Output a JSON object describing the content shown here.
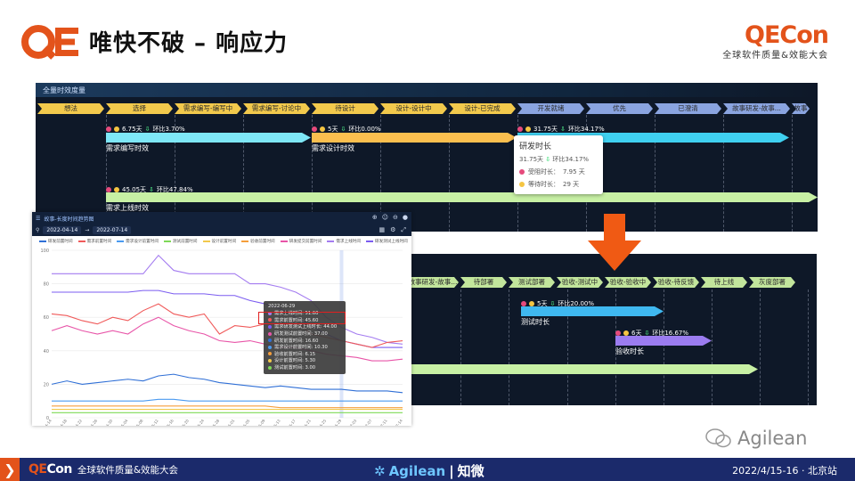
{
  "header": {
    "title": "唯快不破 – 响应力",
    "brand_name_a": "QE",
    "brand_name_b": "Con",
    "brand_sub": "全球软件质量&效能大会"
  },
  "top_panel": {
    "title": "全量时效度量",
    "stages": [
      {
        "label": "想法",
        "color": "#f2c94c"
      },
      {
        "label": "选择",
        "color": "#f2c94c"
      },
      {
        "label": "需求编写-编写中",
        "color": "#f2c94c"
      },
      {
        "label": "需求编写-讨论中",
        "color": "#f2c94c"
      },
      {
        "label": "待设计",
        "color": "#f2c94c"
      },
      {
        "label": "设计-设计中",
        "color": "#f2c94c"
      },
      {
        "label": "设计-已完成",
        "color": "#f2c94c"
      },
      {
        "label": "开发就绪",
        "color": "#8aa4e0"
      },
      {
        "label": "优先",
        "color": "#8aa4e0"
      },
      {
        "label": "已澄清",
        "color": "#8aa4e0"
      },
      {
        "label": "故事研发-故事...",
        "color": "#8aa4e0"
      },
      {
        "label": "故事研",
        "color": "#8aa4e0"
      }
    ],
    "bars": [
      {
        "meta": "6.75天",
        "trend": "环比3.70%",
        "label": "需求编写时效",
        "color": "#7ee7f7"
      },
      {
        "meta": "5天",
        "trend": "环比0.00%",
        "label": "需求设计时效",
        "color": "#fbbf4f"
      },
      {
        "meta": "31.75天",
        "trend": "环比34.17%",
        "label": "",
        "color": "#3fd0f0"
      },
      {
        "meta": "45.05天",
        "trend": "环比47.84%",
        "label": "需求上线时效",
        "color": "#c7f0a4"
      }
    ],
    "tooltip": {
      "title": "研发时长",
      "value": "31.75天",
      "trend": "环比34.17%",
      "rows": [
        {
          "label": "受阻时长：",
          "value": "7.95 天",
          "color": "#e64a7c"
        },
        {
          "label": "等待时长：",
          "value": "29 天",
          "color": "#f5c542"
        }
      ]
    }
  },
  "bottom_panel": {
    "stages": [
      {
        "label": "故事研发-故事...",
        "color": "#c2e59c"
      },
      {
        "label": "待部署",
        "color": "#c2e59c"
      },
      {
        "label": "测试部署",
        "color": "#c2e59c"
      },
      {
        "label": "验收-测试中",
        "color": "#c2e59c"
      },
      {
        "label": "验收-验收中",
        "color": "#c2e59c"
      },
      {
        "label": "验收-待反馈",
        "color": "#c2e59c"
      },
      {
        "label": "待上线",
        "color": "#c2e59c"
      },
      {
        "label": "灰度部署",
        "color": "#c2e59c"
      }
    ],
    "bars": [
      {
        "meta": "5天",
        "trend": "环比20.00%",
        "label": "测试时长",
        "color": "#3fb8f0"
      },
      {
        "meta": "6天",
        "trend": "环比16.67%",
        "label": "验收时长",
        "color": "#9b7cf0"
      }
    ]
  },
  "chart_window": {
    "title": "故事-长度时间趋势图",
    "date_from": "2022-04-14",
    "date_to": "2022-07-14",
    "date_sep": "→",
    "legend": [
      {
        "name": "研发前置时间",
        "color": "#2f6fd6"
      },
      {
        "name": "需求前置时间",
        "color": "#f05a5a"
      },
      {
        "name": "需求设计前置时间",
        "color": "#4a9af0"
      },
      {
        "name": "测试前置时间",
        "color": "#7ed957"
      },
      {
        "name": "设计前置时间",
        "color": "#f2c94c"
      },
      {
        "name": "验收前置时间",
        "color": "#f59e3b"
      },
      {
        "name": "研发提交前置时间",
        "color": "#e855a8"
      },
      {
        "name": "需求上线时间",
        "color": "#a47cf0"
      },
      {
        "name": "研发测试上线时间",
        "color": "#7b5cf0"
      }
    ],
    "tooltip": {
      "date": "2022-06-29",
      "rows": [
        {
          "label": "需求上线时间: 51.60",
          "color": "#a47cf0"
        },
        {
          "label": "需求前置时间: 45.60",
          "color": "#f05a5a"
        },
        {
          "label": "需求研发测试上线时长: 44.00",
          "color": "#7b5cf0"
        },
        {
          "label": "研发测试前置时间: 37.00",
          "color": "#e855a8"
        },
        {
          "label": "研发前置时间: 16.60",
          "color": "#2f6fd6"
        },
        {
          "label": "需求设计前置时间: 10.30",
          "color": "#4a9af0"
        },
        {
          "label": "验收前置时间: 6.15",
          "color": "#f59e3b"
        },
        {
          "label": "设计前置时间: 5.30",
          "color": "#f2c94c"
        },
        {
          "label": "测试前置时间: 3.00",
          "color": "#7ed957"
        }
      ]
    }
  },
  "chart_data": {
    "type": "line",
    "title": "",
    "xlabel": "",
    "ylabel": "",
    "ylim": [
      0,
      100
    ],
    "yticks": [
      "0",
      "20",
      "40",
      "60",
      "80",
      "100"
    ],
    "x": [
      "2022-04-14",
      "2022-04-18",
      "2022-04-22",
      "2022-04-26",
      "2022-04-30",
      "2022-05-04",
      "2022-05-08",
      "2022-05-12",
      "2022-05-16",
      "2022-05-20",
      "2022-05-24",
      "2022-05-28",
      "2022-06-01",
      "2022-06-05",
      "2022-06-09",
      "2022-06-13",
      "2022-06-17",
      "2022-06-21",
      "2022-06-25",
      "2022-06-29",
      "2022-07-03",
      "2022-07-07",
      "2022-07-11",
      "2022-07-14"
    ],
    "series": [
      {
        "name": "需求上线时间",
        "color": "#a47cf0",
        "values": [
          86,
          86,
          86,
          86,
          86,
          86,
          86,
          97,
          88,
          86,
          86,
          86,
          86,
          80,
          80,
          78,
          75,
          70,
          60,
          54,
          50,
          48,
          45,
          44
        ]
      },
      {
        "name": "研发测试上线时间",
        "color": "#7b5cf0",
        "values": [
          75,
          75,
          75,
          75,
          75,
          75,
          76,
          76,
          74,
          74,
          74,
          73,
          73,
          70,
          68,
          65,
          60,
          55,
          50,
          46,
          44,
          42,
          42,
          42
        ]
      },
      {
        "name": "需求前置时间",
        "color": "#f05a5a",
        "values": [
          62,
          61,
          58,
          56,
          60,
          58,
          64,
          68,
          62,
          60,
          62,
          50,
          55,
          54,
          56,
          56,
          58,
          50,
          48,
          46,
          44,
          42,
          45,
          46
        ]
      },
      {
        "name": "研发提交前置时间",
        "color": "#e855a8",
        "values": [
          52,
          55,
          52,
          50,
          52,
          50,
          56,
          60,
          55,
          52,
          50,
          46,
          45,
          46,
          44,
          42,
          42,
          40,
          38,
          37,
          36,
          34,
          34,
          35
        ]
      },
      {
        "name": "研发前置时间",
        "color": "#2f6fd6",
        "values": [
          20,
          22,
          20,
          21,
          22,
          23,
          22,
          25,
          26,
          24,
          23,
          21,
          20,
          19,
          18,
          19,
          18,
          17,
          17,
          17,
          16,
          16,
          16,
          15
        ]
      },
      {
        "name": "需求设计前置时间",
        "color": "#4a9af0",
        "values": [
          10,
          10,
          10,
          10,
          10,
          10,
          10,
          11,
          11,
          10,
          10,
          10,
          10,
          10,
          10,
          10,
          10,
          10,
          10,
          10,
          10,
          10,
          10,
          10
        ]
      },
      {
        "name": "验收前置时间",
        "color": "#f59e3b",
        "values": [
          7,
          7,
          7,
          7,
          7,
          7,
          7,
          7,
          7,
          7,
          7,
          7,
          7,
          7,
          7,
          6,
          6,
          6,
          6,
          6,
          6,
          6,
          6,
          6
        ]
      },
      {
        "name": "设计前置时间",
        "color": "#f2c94c",
        "values": [
          5,
          5,
          5,
          5,
          5,
          5,
          5,
          5,
          5,
          5,
          5,
          5,
          5,
          5,
          5,
          5,
          5,
          5,
          5,
          5,
          5,
          5,
          5,
          5
        ]
      },
      {
        "name": "测试前置时间",
        "color": "#7ed957",
        "values": [
          3,
          3,
          3,
          3,
          3,
          3,
          3,
          3,
          3,
          3,
          3,
          3,
          3,
          3,
          3,
          3,
          3,
          3,
          3,
          3,
          3,
          3,
          3,
          3
        ]
      }
    ]
  },
  "watermark": {
    "text": "Agilean"
  },
  "footer": {
    "brand_a": "QE",
    "brand_b": "Con",
    "event": "全球软件质量&效能大会",
    "sponsor_a": "Agilean",
    "sponsor_b": "知微",
    "sponsor_sep": "|",
    "date": "2022/4/15-16 · 北京站"
  }
}
